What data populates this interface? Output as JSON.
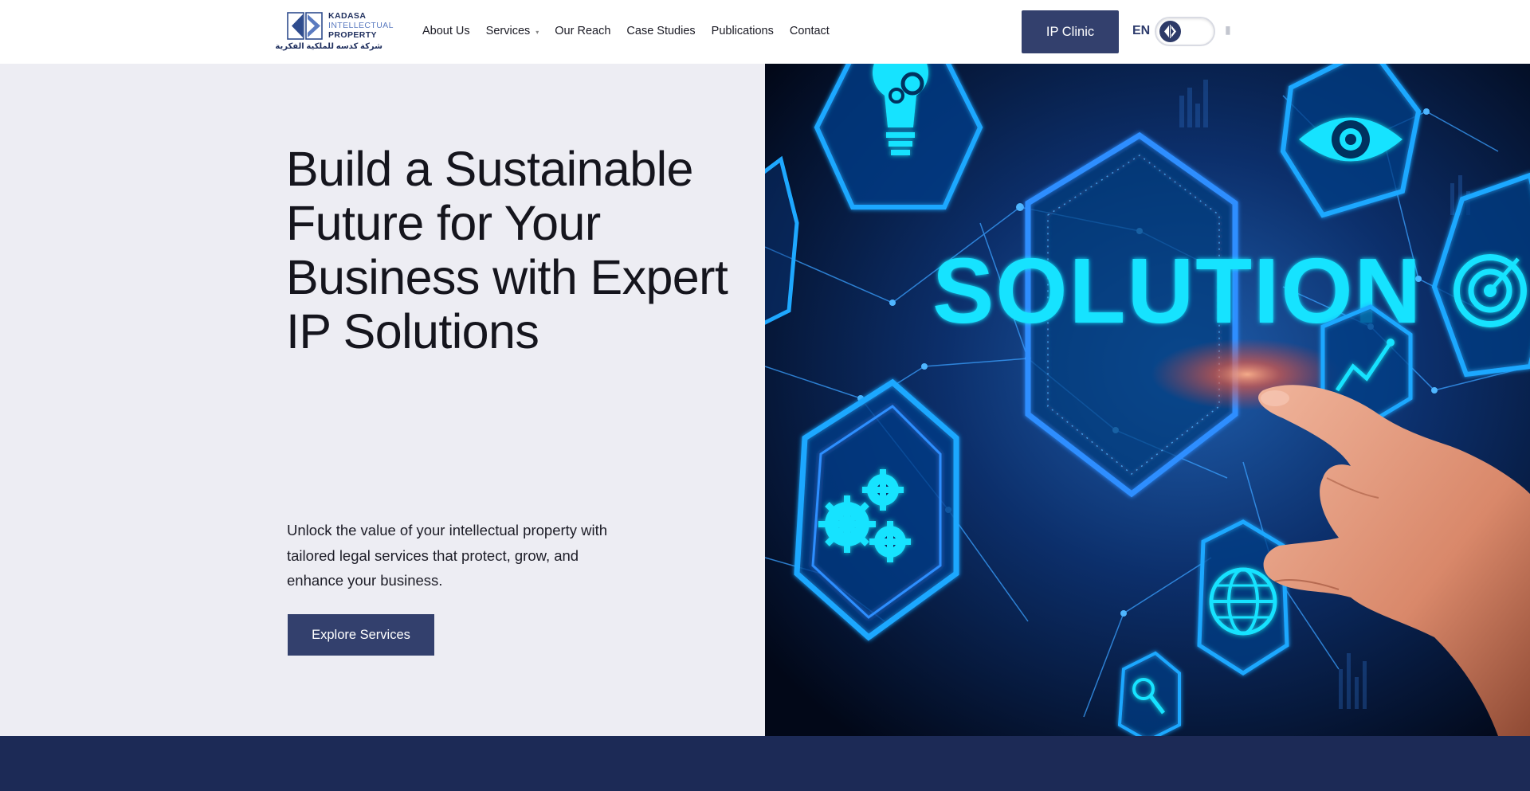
{
  "header": {
    "logo": {
      "line1": "KADASA",
      "line2": "INTELLECTUAL",
      "line3": "PROPERTY",
      "arabic": "شركة كدسه للملكية الفكرية"
    },
    "nav": [
      {
        "label": "About Us"
      },
      {
        "label": "Services",
        "has_dropdown": true
      },
      {
        "label": "Our Reach"
      },
      {
        "label": "Case Studies"
      },
      {
        "label": "Publications"
      },
      {
        "label": "Contact"
      }
    ],
    "clinic_button": "IP Clinic",
    "language": "EN",
    "search_icon": "search-icon"
  },
  "hero": {
    "title": "Build a Sustainable Future for Your Business with Expert IP Solutions",
    "description": "Unlock the value of your intellectual property with tailored legal services that protect, grow, and enhance your business.",
    "cta": "Explore Services",
    "image_text": "SOLUTION"
  },
  "colors": {
    "primary": "#33406d",
    "hero_bg": "#ededf3",
    "footer_band": "#1c2a56",
    "accent_cyan": "#19e3ff"
  }
}
